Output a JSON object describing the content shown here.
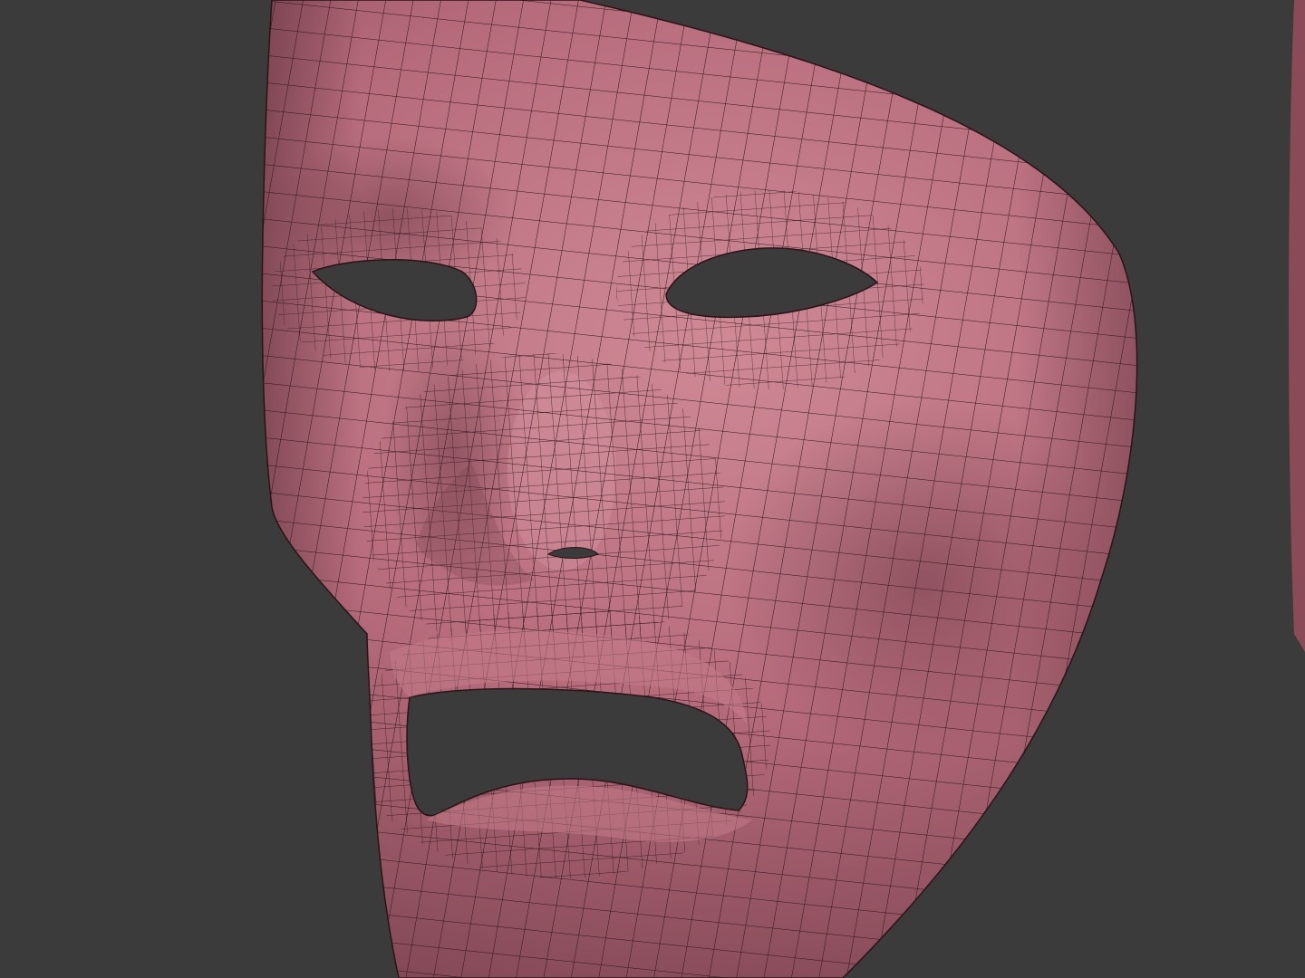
{
  "scene": {
    "subject": "mask-mesh",
    "colors": {
      "background": "#3b3b3b",
      "surface": "#b66b7b",
      "surface_highlight": "#cf8a96",
      "surface_shadow": "#6e3a47",
      "wire": "#2a1418"
    }
  }
}
